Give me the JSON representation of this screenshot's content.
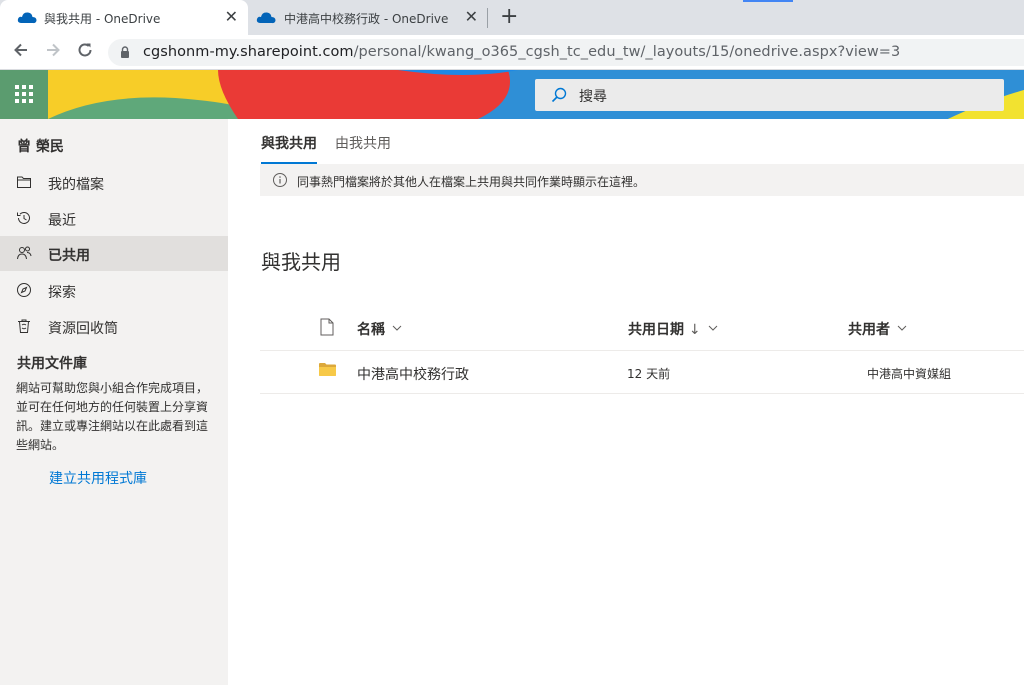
{
  "browser": {
    "tabs": [
      {
        "title": "與我共用 - OneDrive",
        "active": true
      },
      {
        "title": "中港高中校務行政 - OneDrive",
        "active": false
      }
    ],
    "close_glyph": "✕",
    "new_tab_glyph": "+",
    "url": {
      "host": "cgshonm-my.sharepoint.com",
      "path": "/personal/kwang_o365_cgsh_tc_edu_tw/_layouts/15/onedrive.aspx?view=3"
    }
  },
  "header": {
    "search_placeholder": "搜尋",
    "colors": {
      "waffle_bg": "#5b9c6f",
      "accent": "#0078d4"
    }
  },
  "sidebar": {
    "user_name": "曾 榮民",
    "items": [
      {
        "label": "我的檔案",
        "icon": "folder-icon"
      },
      {
        "label": "最近",
        "icon": "history-icon"
      },
      {
        "label": "已共用",
        "icon": "people-icon",
        "selected": true
      },
      {
        "label": "探索",
        "icon": "compass-icon"
      },
      {
        "label": "資源回收筒",
        "icon": "recycle-bin-icon"
      }
    ],
    "shared_libraries": {
      "title": "共用文件庫",
      "description": "網站可幫助您與小組合作完成項目，並可在任何地方的任何裝置上分享資訊。建立或專注網站以在此處看到這些網站。",
      "create_link": "建立共用程式庫"
    }
  },
  "main": {
    "tabs": [
      "與我共用",
      "由我共用"
    ],
    "info_text": "同事熱門檔案將於其他人在檔案上共用與共同作業時顯示在這裡。",
    "page_title": "與我共用",
    "columns": {
      "name": "名稱",
      "shared_date": "共用日期",
      "sort_arrow": "↓",
      "shared_by": "共用者"
    },
    "rows": [
      {
        "name": "中港高中校務行政",
        "shared_date": "12 天前",
        "shared_by": "中港高中資媒組",
        "icon": "folder-icon"
      }
    ]
  }
}
